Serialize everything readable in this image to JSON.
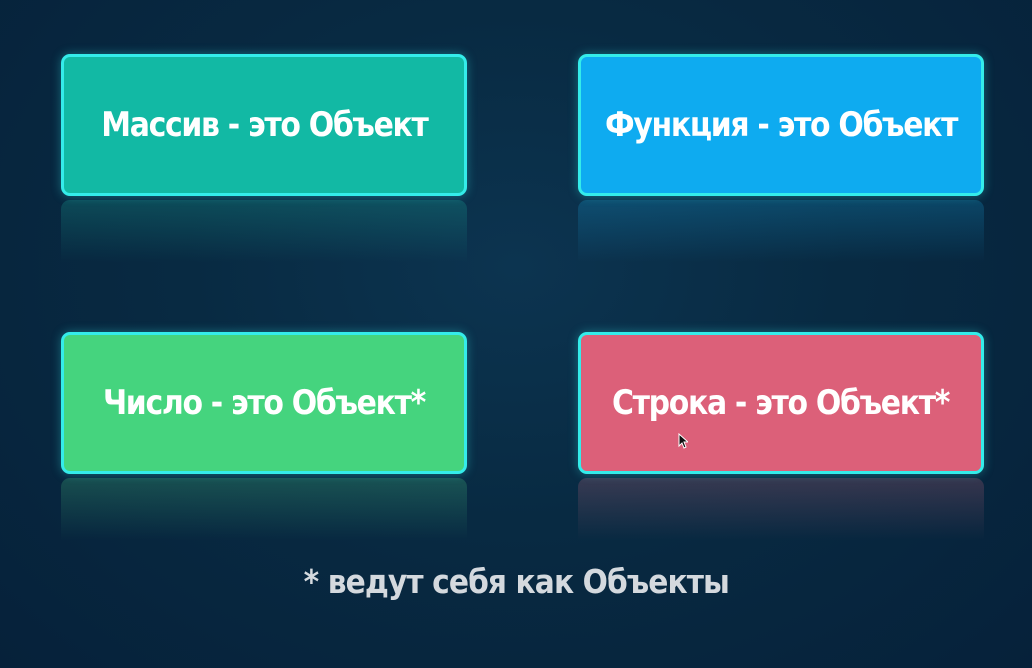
{
  "cards": [
    {
      "id": "array",
      "label": "Массив - это Объект",
      "color": "#12b9a4"
    },
    {
      "id": "function",
      "label": "Функция - это Объект",
      "color": "#0eabf0"
    },
    {
      "id": "number",
      "label": "Число - это Объект*",
      "color": "#45d47e"
    },
    {
      "id": "string",
      "label": "Строка - это Объект*",
      "color": "#dc6079"
    }
  ],
  "footnote": "* ведут себя как Объекты",
  "colors": {
    "background": "#082a42",
    "card_border": "#34ecea",
    "footnote_text": "#d4d9de"
  },
  "cursor_icon": "arrow-pointer-icon"
}
